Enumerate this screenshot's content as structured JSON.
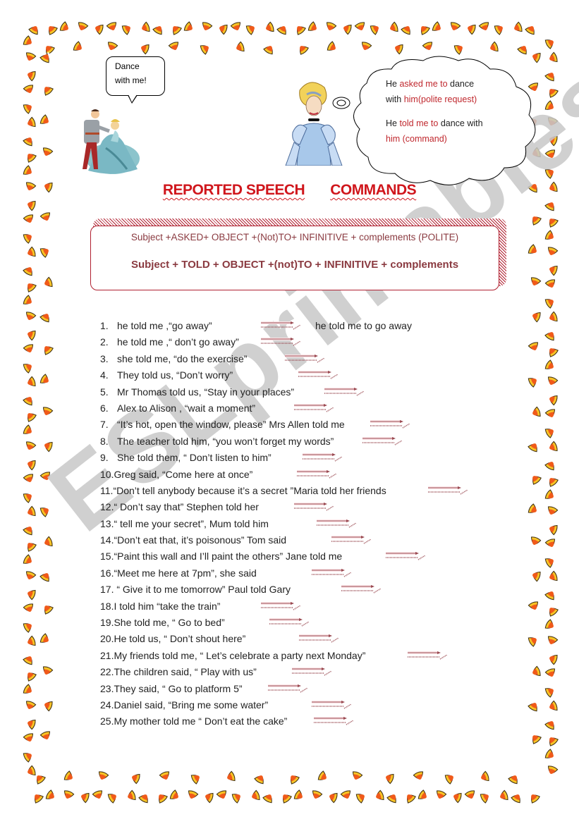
{
  "speech_bubble": {
    "line1": "Dance",
    "line2": "with me!"
  },
  "thought_cloud": {
    "polite": {
      "pre": "He ",
      "highlight": "asked me to",
      "mid": " dance",
      "line2_pre": "with ",
      "line2_highlight": "him(polite request)"
    },
    "command": {
      "pre": "He ",
      "highlight": "told me to",
      "mid": " dance with",
      "line2_highlight": "him (command)"
    }
  },
  "title": {
    "part1": "REPORTED SPEECH",
    "part2": "COMMANDS"
  },
  "rules": {
    "polite": "Subject +ASKED+ OBJECT +(Not)TO+ INFINITIVE + complements (POLITE)",
    "command": "Subject + TOLD + OBJECT +(not)TO + INFINITIVE + complements"
  },
  "exercises": [
    {
      "num": "1.",
      "text": "he told me ,“go away”",
      "answer": "he told me to go away"
    },
    {
      "num": "2.",
      "text": "he told me ,“ don’t go away”"
    },
    {
      "num": "3.",
      "text": "she told me, “do the exercise”"
    },
    {
      "num": "4.",
      "text": "They told us, “Don’t worry”"
    },
    {
      "num": "5.",
      "text": "Mr Thomas told us, “Stay in your places”"
    },
    {
      "num": "6.",
      "text": "Alex to Alison , “wait a moment”"
    },
    {
      "num": "7.",
      "text": "“It’s hot, open the window, please” Mrs Allen told me"
    },
    {
      "num": "8.",
      "text": "The teacher told him, “you won’t forget my words”"
    },
    {
      "num": "9.",
      "text": "She told them, “ Don’t listen to him”"
    },
    {
      "num": "10.",
      "text": "Greg said, “Come here at once”"
    },
    {
      "num": "11.",
      "text": "“Don’t tell anybody because it’s a secret ”Maria told her friends"
    },
    {
      "num": "12.",
      "text": "“ Don’t say that” Stephen told her"
    },
    {
      "num": "13.",
      "text": "“ tell me your secret”, Mum told him"
    },
    {
      "num": "14.",
      "text": "“Don’t eat that, it’s poisonous” Tom said"
    },
    {
      "num": "15.",
      "text": "“Paint this wall and I’ll paint the others” Jane told me"
    },
    {
      "num": "16.",
      "text": "“Meet me  here at 7pm”, she said"
    },
    {
      "num": "17.",
      "text": " “ Give it to me tomorrow” Paul told Gary"
    },
    {
      "num": "18.",
      "text": "I told him “take the train”"
    },
    {
      "num": "19.",
      "text": "She told me, “ Go to bed”"
    },
    {
      "num": "20.",
      "text": "He told us, “ Don’t shout here”"
    },
    {
      "num": "21.",
      "text": "My friends told me, “ Let’s celebrate a party next Monday”"
    },
    {
      "num": "22.",
      "text": "The children said, “ Play with us”"
    },
    {
      "num": "23.",
      "text": "They said, “ Go to platform 5”"
    },
    {
      "num": "24.",
      "text": "Daniel said, “Bring me some water”"
    },
    {
      "num": "25.",
      "text": "My mother told me “ Don’t eat the cake”"
    }
  ],
  "watermark": "ESLprintables.com",
  "colors": {
    "accent_red": "#d0161c",
    "rule_text": "#8a3a40",
    "candy_orange": "#f05a1a",
    "candy_yellow": "#f7c325"
  }
}
